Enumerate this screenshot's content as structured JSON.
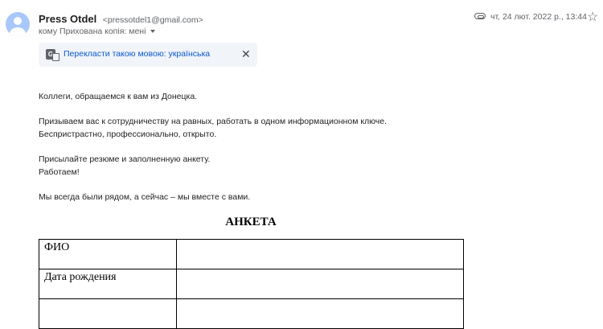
{
  "sender": {
    "name": "Press Otdel",
    "email": "<pressotdel1@gmail.com>"
  },
  "recipient": {
    "text": "кому Прихована копія: мені",
    "icon": "chevron-down-icon"
  },
  "date": "чт, 24 лют. 2022 р., 13:44",
  "icons": {
    "attachment": "paperclip-icon",
    "star": "star-icon",
    "translate": "translate-icon",
    "close": "close-icon"
  },
  "translate_bar": {
    "link": "Перекласти такою мовою: українська"
  },
  "body": {
    "greeting": "Коллеги, обращаемся к вам из Донецка.",
    "para2_line1": "Призываем вас к сотрудничеству на равных, работать в одном информационном ключе.",
    "para2_line2": "Беспристрастно, профессионально, открыто.",
    "para3_line1": "Присылайте резюме и заполненную анкету.",
    "para3_line2": "Работаем!",
    "para4": "Мы всегда были рядом, а сейчас – мы  вместе с вами."
  },
  "form": {
    "title": "АНКЕТА",
    "rows": [
      {
        "label": "ФИО",
        "value": ""
      },
      {
        "label": "Дата рождения",
        "value": ""
      },
      {
        "label": "",
        "value": ""
      }
    ]
  },
  "colors": {
    "link": "#0b57d0",
    "avatar": "#a8c7fa",
    "translate_bg": "#f1f4f9"
  }
}
